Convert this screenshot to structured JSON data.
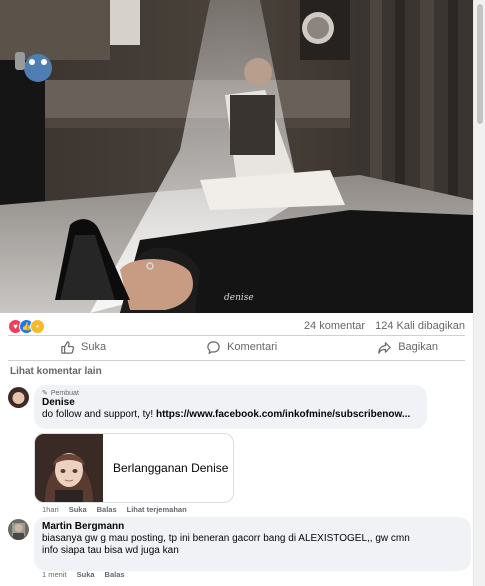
{
  "post": {
    "photo_signature": "denise",
    "stats": {
      "comments": "24 komentar",
      "shares": "124 Kali dibagikan",
      "reaction_icons": [
        "love-icon",
        "like-icon",
        "haha-icon"
      ]
    },
    "actions": {
      "like": "Suka",
      "comment": "Komentari",
      "share": "Bagikan"
    }
  },
  "comments": {
    "view_more": "Lihat komentar lain",
    "items": [
      {
        "author_tag": "Pembuat",
        "author": "Denise",
        "text_prefix": "do follow and support, ty! ",
        "link": "https://www.facebook.com/inkofmine/subscribenow...",
        "card_label": "Berlangganan Denise",
        "time": "1hari",
        "like": "Suka",
        "reply": "Balas",
        "translate": "Lihat terjemahan"
      },
      {
        "author": "Martin Bergmann",
        "line1": "biasanya gw g mau posting, tp ini beneran gacorr bang di ALEXISTOGEL,, gw cmn",
        "line2": "info siapa tau bisa wd juga kan",
        "time": "1 menit",
        "like": "Suka",
        "reply": "Balas"
      }
    ]
  },
  "colors": {
    "text": "#050505",
    "muted": "#65676b",
    "bubble": "#f0f2f5",
    "like_blue": "#1877f2",
    "love_red": "#f33e58",
    "haha_yellow": "#f7b928"
  }
}
